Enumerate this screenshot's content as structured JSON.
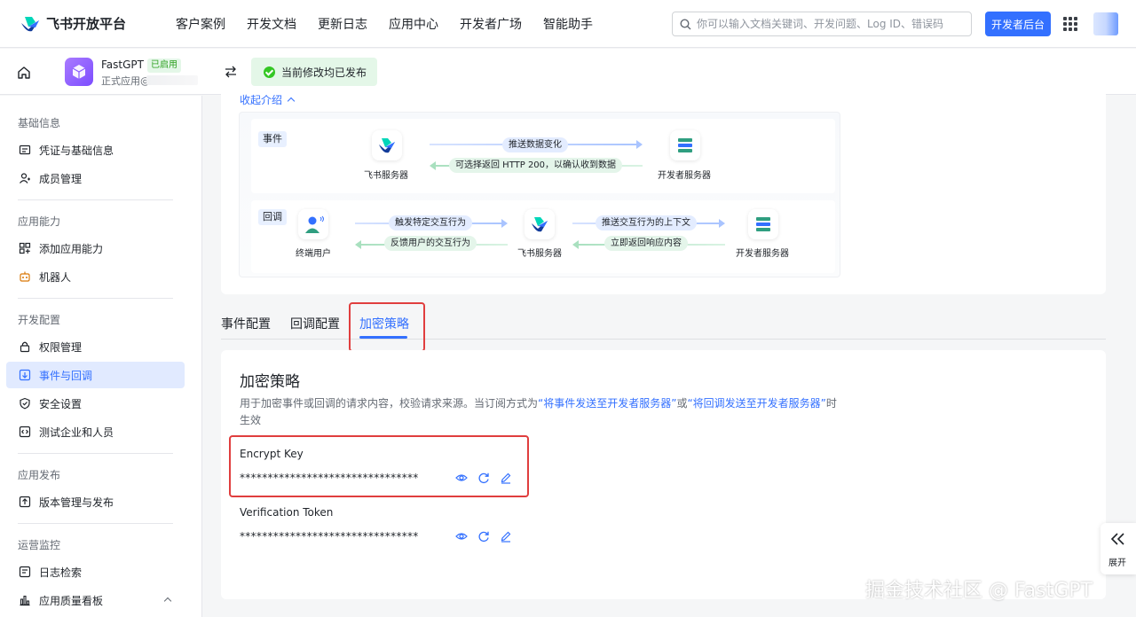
{
  "topnav": {
    "brand": "飞书开放平台",
    "links": [
      "客户案例",
      "开发文档",
      "更新日志",
      "应用中心",
      "开发者广场",
      "智能助手"
    ],
    "search_placeholder": "你可以输入文档关键词、开发问题、Log ID、错误码",
    "dev_console": "开发者后台"
  },
  "app": {
    "name": "FastGPT",
    "status": "已启用",
    "sub": "正式应用@",
    "publish_status": "当前修改均已发布"
  },
  "sidebar": {
    "groups": [
      "基础信息",
      "应用能力",
      "开发配置",
      "应用发布",
      "运营监控"
    ],
    "items": [
      {
        "label": "凭证与基础信息",
        "icon": "id-card-icon"
      },
      {
        "label": "成员管理",
        "icon": "user-add-icon"
      },
      {
        "label": "添加应用能力",
        "icon": "grid-add-icon"
      },
      {
        "label": "机器人",
        "icon": "robot-icon"
      },
      {
        "label": "权限管理",
        "icon": "lock-icon"
      },
      {
        "label": "事件与回调",
        "icon": "event-icon"
      },
      {
        "label": "安全设置",
        "icon": "shield-icon"
      },
      {
        "label": "测试企业和人员",
        "icon": "code-icon"
      },
      {
        "label": "版本管理与发布",
        "icon": "upload-icon"
      },
      {
        "label": "日志检索",
        "icon": "log-icon"
      },
      {
        "label": "应用质量看板",
        "icon": "chart-icon"
      }
    ]
  },
  "intro": {
    "collapse_label": "收起介绍",
    "event": {
      "tag": "事件",
      "from": "飞书服务器",
      "to": "开发者服务器",
      "push": "推送数据变化",
      "ack": "可选择返回 HTTP 200，以确认收到数据"
    },
    "callback": {
      "tag": "回调",
      "user": "终端用户",
      "server": "飞书服务器",
      "dev": "开发者服务器",
      "trigger": "触发特定交互行为",
      "feedback": "反馈用户的交互行为",
      "push_ctx": "推送交互行为的上下文",
      "respond": "立即返回响应内容"
    }
  },
  "tabs": [
    "事件配置",
    "回调配置",
    "加密策略"
  ],
  "encryption": {
    "title": "加密策略",
    "desc_a": "用于加密事件或回调的请求内容，校验请求来源。当订阅方式为",
    "desc_link1": "“将事件发送至开发者服务器”",
    "desc_b": "或",
    "desc_link2": "“将回调发送至开发者服务器”",
    "desc_c": "时生效",
    "encrypt_key_label": "Encrypt Key",
    "encrypt_key_value": "********************************",
    "token_label": "Verification Token",
    "token_value": "********************************"
  },
  "expand_label": "展开",
  "watermark": "掘金技术社区 @ FastGPT",
  "colors": {
    "accent": "#3370ff",
    "highlight_box": "#e03e3e",
    "success": "#34c724"
  }
}
